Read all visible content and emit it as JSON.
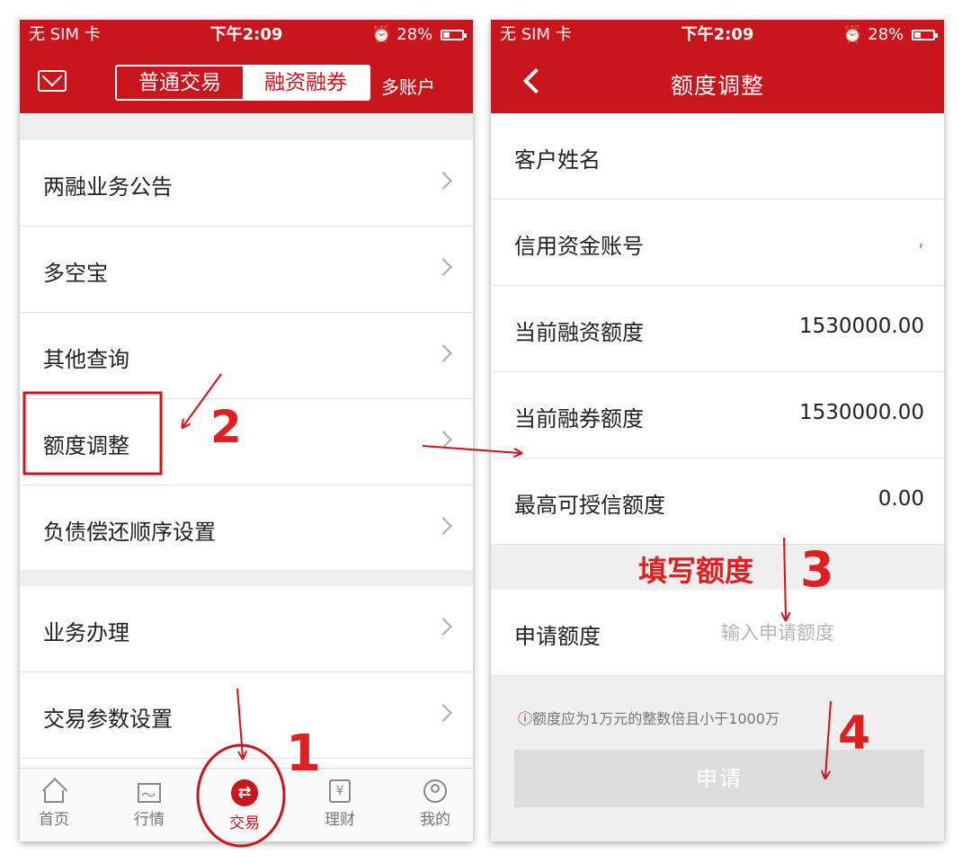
{
  "status_bar": {
    "carrier": "无 SIM 卡",
    "time": "下午2:09",
    "battery": "28%"
  },
  "left_screen": {
    "segments": [
      "普通交易",
      "融资融券"
    ],
    "multi_account": "多账户",
    "menu": [
      "两融业务公告",
      "多空宝",
      "其他查询",
      "额度调整",
      "负债偿还顺序设置",
      "业务办理",
      "交易参数设置"
    ],
    "tabs": [
      "首页",
      "行情",
      "交易",
      "理财",
      "我的"
    ]
  },
  "right_screen": {
    "title": "额度调整",
    "rows": [
      {
        "label": "客户姓名",
        "value": ""
      },
      {
        "label": "信用资金账号",
        "value": ","
      },
      {
        "label": "当前融资额度",
        "value": "1530000.00"
      },
      {
        "label": "当前融券额度",
        "value": "1530000.00"
      },
      {
        "label": "最高可授信额度",
        "value": "0.00"
      }
    ],
    "apply_label": "申请额度",
    "apply_placeholder": "输入申请额度",
    "hint_icon": "ⓘ",
    "hint": "额度应为1万元的整数倍且小于1000万",
    "submit": "申请"
  },
  "annotations": {
    "step1": "1",
    "step2": "2",
    "step3_text": "填写额度",
    "step3": "3",
    "step4": "4"
  },
  "colors": {
    "brand": "#c9161d",
    "annotation": "#e02020"
  },
  "icons": [
    "mail-icon",
    "back-icon",
    "home-icon",
    "chart-icon",
    "trade-icon",
    "wealth-icon",
    "profile-icon",
    "chevron-right-icon",
    "info-icon"
  ]
}
